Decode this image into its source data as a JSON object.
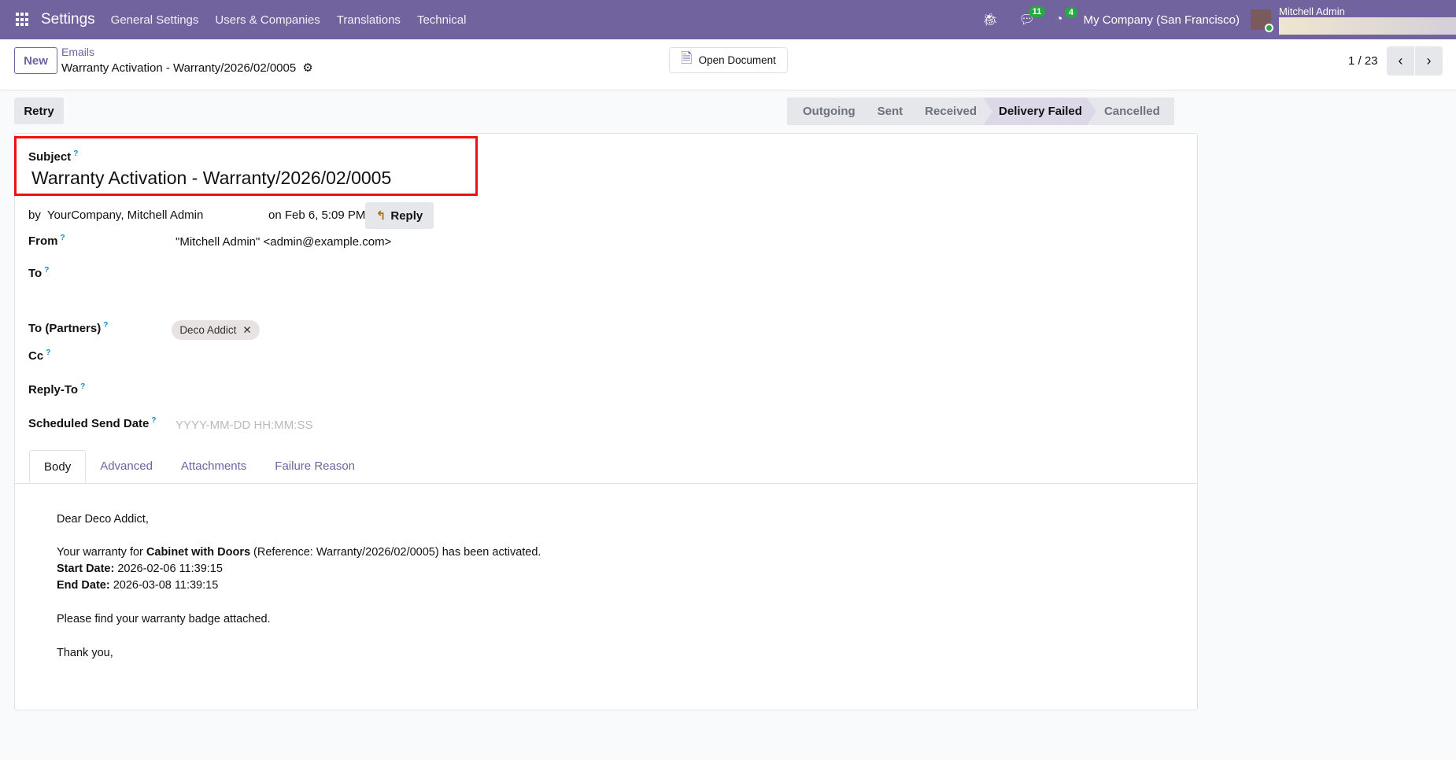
{
  "navbar": {
    "app": "Settings",
    "menu": [
      "General Settings",
      "Users & Companies",
      "Translations",
      "Technical"
    ],
    "messages_count": "11",
    "activities_count": "4",
    "company": "My Company (San Francisco)",
    "user": "Mitchell Admin",
    "color": "#71639e"
  },
  "control_panel": {
    "new_label": "New",
    "breadcrumb": "Emails",
    "record_title": "Warranty Activation - Warranty/2026/02/0005",
    "open_document": "Open Document",
    "pager": "1 / 23"
  },
  "actions": {
    "retry": "Retry"
  },
  "statusbar": {
    "stages": [
      "Outgoing",
      "Sent",
      "Received",
      "Delivery Failed",
      "Cancelled"
    ],
    "active": "Delivery Failed"
  },
  "form": {
    "subject_label": "Subject",
    "subject": "Warranty Activation - Warranty/2026/02/0005",
    "by_prefix": "by",
    "authors": "YourCompany, Mitchell Admin",
    "date": "on Feb 6, 5:09 PM",
    "reply": "Reply",
    "from_label": "From",
    "from": "\"Mitchell Admin\" <admin@example.com>",
    "to_label": "To",
    "to_partners_label": "To (Partners)",
    "partner_tag": "Deco Addict",
    "cc_label": "Cc",
    "reply_to_label": "Reply-To",
    "scheduled_label": "Scheduled Send Date",
    "scheduled_placeholder": "YYYY-MM-DD HH:MM:SS",
    "help": "?"
  },
  "tabs": [
    "Body",
    "Advanced",
    "Attachments",
    "Failure Reason"
  ],
  "body": {
    "greeting": "Dear Deco Addict,",
    "l1a": "Your warranty for ",
    "product": "Cabinet with Doors",
    "l1b": " (Reference: Warranty/2026/02/0005) has been activated.",
    "start_label": "Start Date:",
    "start": " 2026-02-06 11:39:15",
    "end_label": "End Date:",
    "end": " 2026-03-08 11:39:15",
    "badge": "Please find your warranty badge attached.",
    "thanks": "Thank you,"
  }
}
